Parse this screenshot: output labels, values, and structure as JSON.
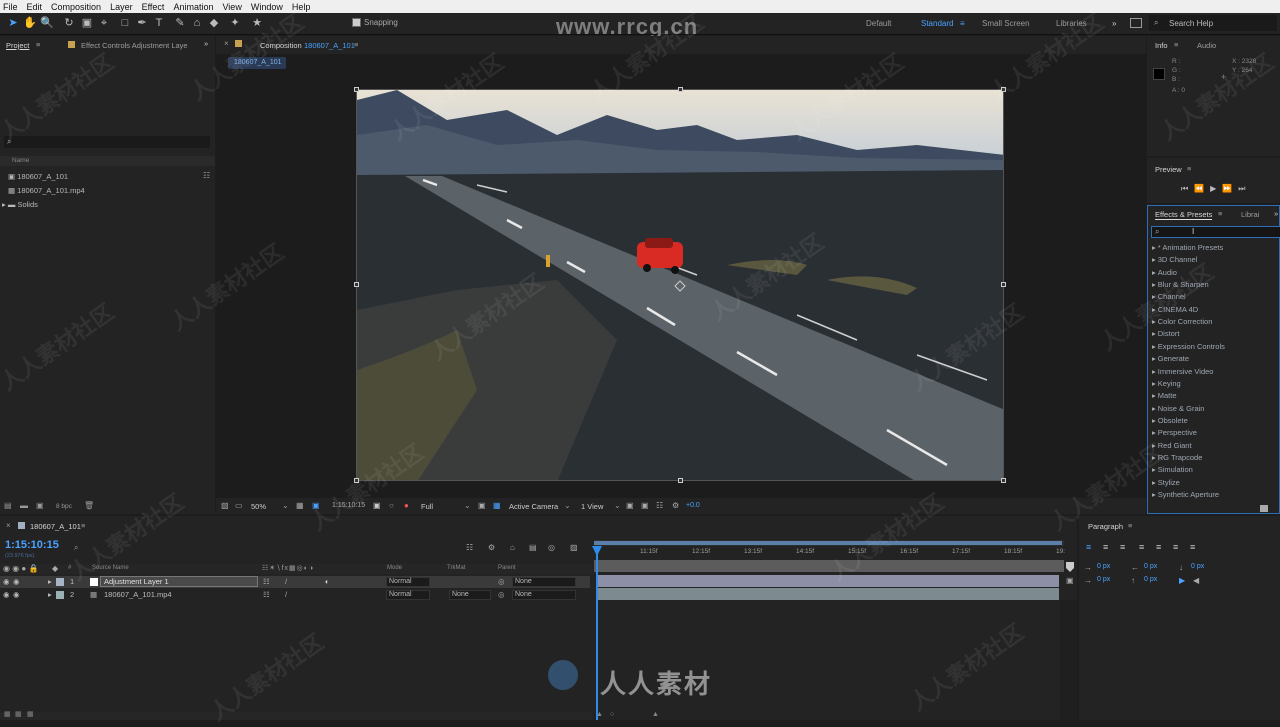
{
  "menu": [
    "File",
    "Edit",
    "Composition",
    "Layer",
    "Effect",
    "Animation",
    "View",
    "Window",
    "Help"
  ],
  "toolbar": {
    "snapping": "Snapping"
  },
  "workspaces": [
    "Default",
    "Standard",
    "Small Screen",
    "Libraries"
  ],
  "active_workspace": "Standard",
  "search_help": "Search Help",
  "watermark_top": "www.rrcg.cn",
  "watermark_bottom": "人人素材",
  "watermark_tile": "人人素材社区",
  "project": {
    "tab": "Project",
    "effect_controls_tab": "Effect Controls Adjustment Laye",
    "col_name": "Name",
    "items": [
      "180607_A_101",
      "180607_A_101.mp4",
      "Solids"
    ],
    "bpc": "8 bpc"
  },
  "composition": {
    "tab_prefix": "Composition",
    "tab_name": "180607_A_101",
    "sub_tab": "180607_A_101",
    "zoom": "50%",
    "timecode": "1:15:10:15",
    "resolution": "Full",
    "camera": "Active Camera",
    "view": "1 View",
    "exposure": "+0.0"
  },
  "info": {
    "tab": "Info",
    "audio_tab": "Audio",
    "r": "R :",
    "g": "G :",
    "b": "B :",
    "a": "A : 0",
    "x": "X : 2328",
    "y": "Y : 264"
  },
  "preview": {
    "tab": "Preview"
  },
  "effects": {
    "tab": "Effects & Presets",
    "lib_tab": "Librai",
    "items": [
      "* Animation Presets",
      "3D Channel",
      "Audio",
      "Blur & Sharpen",
      "Channel",
      "CINEMA 4D",
      "Color Correction",
      "Distort",
      "Expression Controls",
      "Generate",
      "Immersive Video",
      "Keying",
      "Matte",
      "Noise & Grain",
      "Obsolete",
      "Perspective",
      "Red Giant",
      "RG Trapcode",
      "Simulation",
      "Stylize",
      "Synthetic Aperture"
    ]
  },
  "timeline": {
    "tab": "180607_A_101",
    "timecode": "1:15:10:15",
    "fps": "(23.976 fps)",
    "col_source": "Source Name",
    "col_mode": "Mode",
    "col_trkmat": "TrkMat",
    "col_parent": "Parent",
    "ticks": [
      "11:15f",
      "12:15f",
      "13:15f",
      "14:15f",
      "15:15f",
      "16:15f",
      "17:15f",
      "18:15f",
      "19:"
    ],
    "layers": [
      {
        "num": "1",
        "name": "Adjustment Layer 1",
        "mode": "Normal",
        "trkmat": "",
        "parent": "None"
      },
      {
        "num": "2",
        "name": "180607_A_101.mp4",
        "mode": "Normal",
        "trkmat": "None",
        "parent": "None"
      }
    ]
  },
  "paragraph": {
    "tab": "Paragraph",
    "px1": "0 px",
    "px2": "0 px",
    "px3": "0 px",
    "px4": "0 px",
    "px5": "0 px"
  },
  "colors": {
    "accent": "#2d8ceb",
    "layer_bar": "#8c8fa6",
    "layer_bar2": "#7d8a8f"
  }
}
